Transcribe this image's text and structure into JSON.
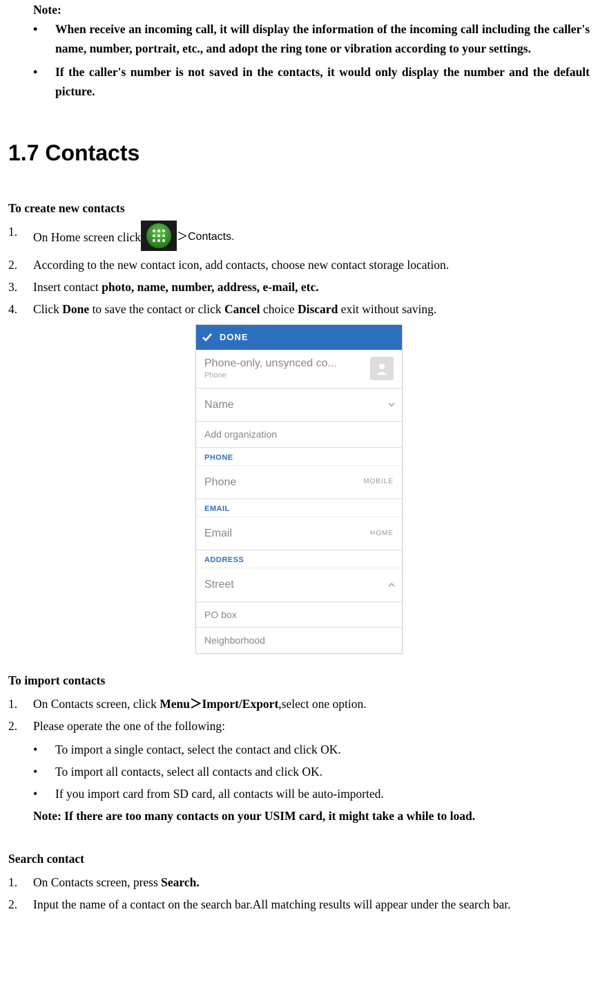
{
  "top_note": {
    "header": "Note:",
    "bullets": [
      "When receive an incoming call, it will display the information of the incoming call including the caller's name, number, portrait, etc., and adopt the ring tone or vibration according to your settings.",
      "If the caller's number is not saved in the contacts, it would only display the number and the default picture."
    ]
  },
  "section_title": "1.7 Contacts",
  "create": {
    "header": "To create new contacts",
    "step1_prefix": "On Home screen click",
    "step1_suffix": "＞Contacts.",
    "step2": "According to the new contact icon, add contacts, choose new contact storage location.",
    "step3_prefix": "Insert contact ",
    "step3_bold": "photo, name, number, address, e-mail, etc.",
    "step4_p1": "Click ",
    "step4_b1": "Done",
    "step4_p2": " to save the contact or click ",
    "step4_b2": "Cancel",
    "step4_p3": " choice ",
    "step4_b3": "Discard",
    "step4_p4": " exit without saving.",
    "nums": {
      "n1": "1.",
      "n2": "2.",
      "n3": "3.",
      "n4": "4."
    }
  },
  "phone_ui": {
    "done": "DONE",
    "contact_type_main": "Phone-only, unsynced co...",
    "contact_type_sub": "Phone",
    "name": "Name",
    "add_org": "Add organization",
    "section_phone": "PHONE",
    "phone": "Phone",
    "phone_type": "MOBILE",
    "section_email": "EMAIL",
    "email": "Email",
    "email_type": "HOME",
    "section_address": "ADDRESS",
    "street": "Street",
    "pobox": "PO box",
    "neighborhood": "Neighborhood"
  },
  "import": {
    "header": "To import contacts",
    "step1_p1": "On Contacts screen, click ",
    "step1_b1": "Menu＞Import/Export",
    "step1_p2": ",select one option.",
    "step2": "Please operate the one of the following:",
    "bullets": [
      "To import a single contact, select the contact and click OK.",
      "To import all contacts, select all contacts and click OK.",
      "If you import card from SD card, all contacts will be auto-imported."
    ],
    "note": "Note: If there are too many contacts on your USIM card, it might take a while to load.",
    "nums": {
      "n1": "1.",
      "n2": "2."
    }
  },
  "search": {
    "header": "Search contact",
    "step1_p1": "On Contacts screen, press ",
    "step1_b1": "Search.",
    "step2": "Input the name of a contact on the search bar.All matching results will appear under the search bar.",
    "nums": {
      "n1": "1.",
      "n2": "2."
    }
  }
}
